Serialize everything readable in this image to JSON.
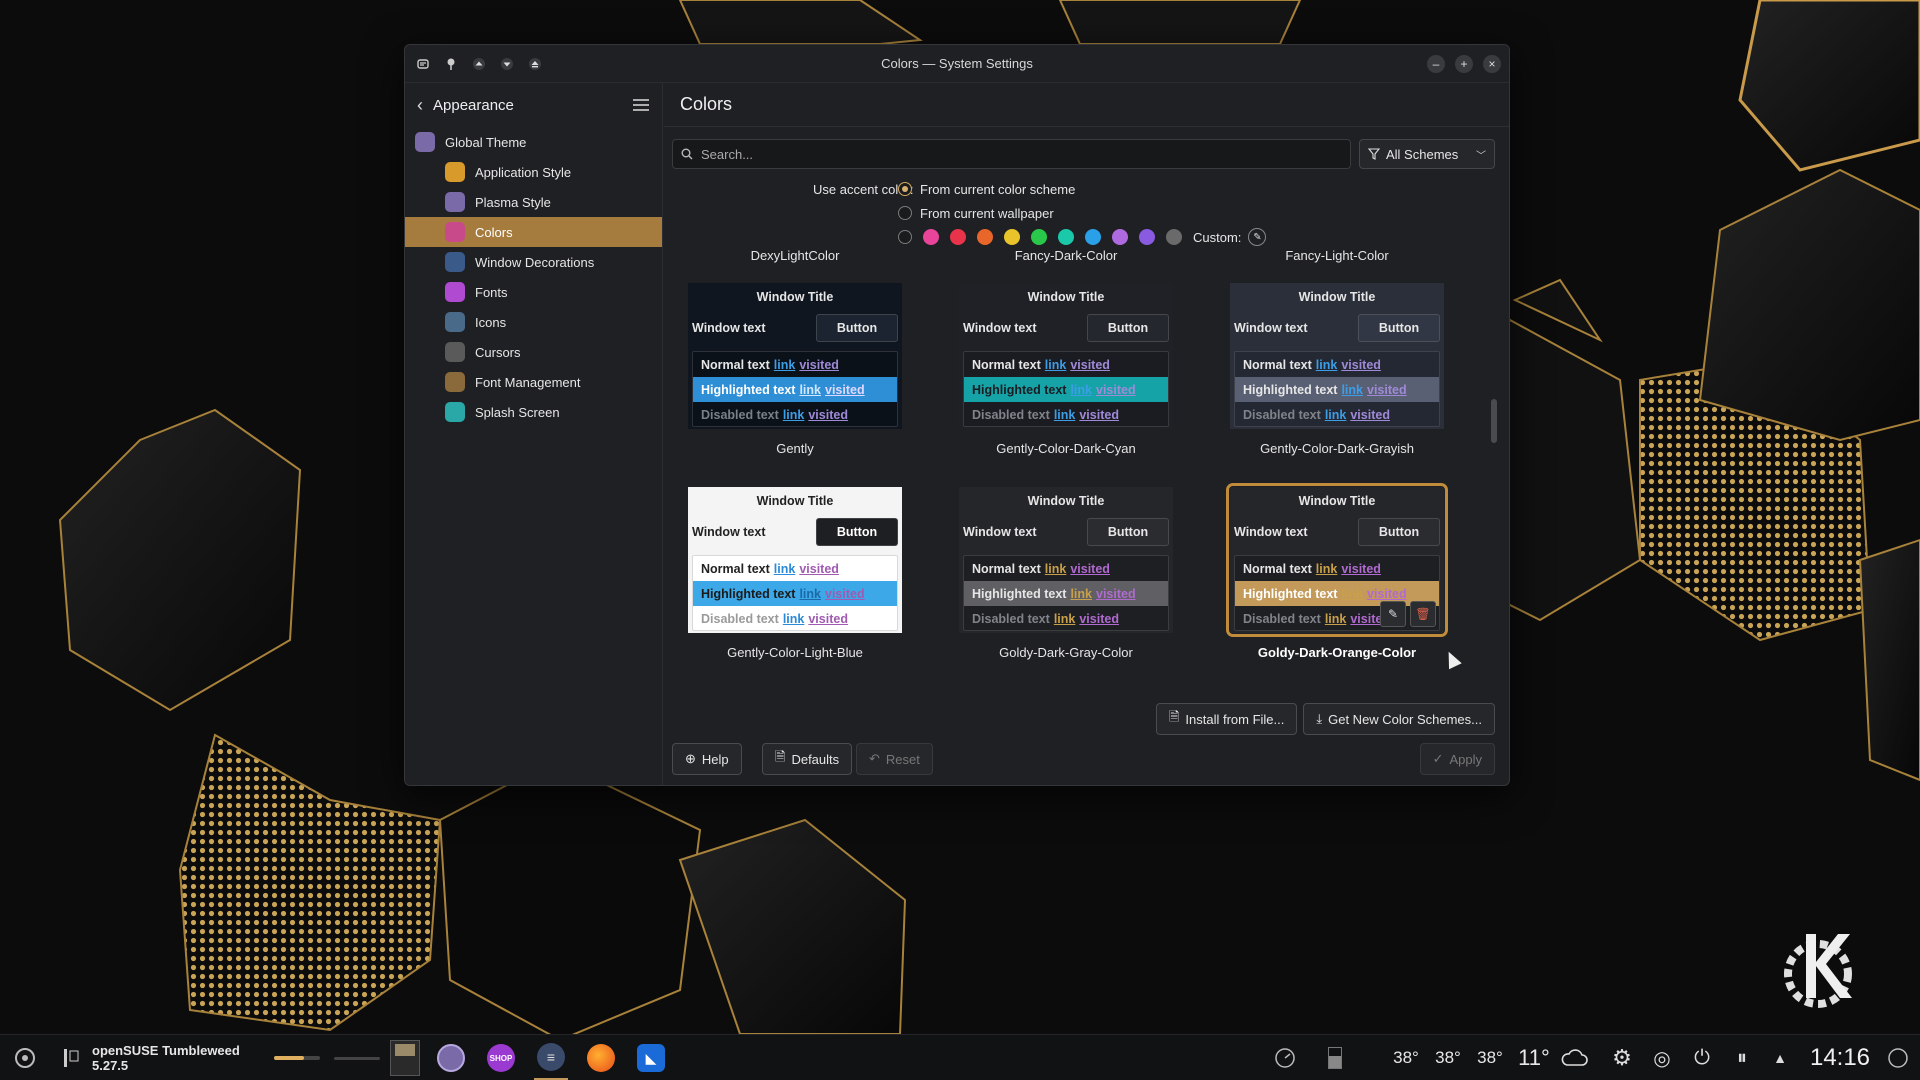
{
  "window": {
    "title": "Colors — System Settings"
  },
  "sidebar": {
    "title": "Appearance",
    "items": [
      {
        "label": "Global Theme",
        "icon": "global-theme-icon",
        "color": "#7a6aa8"
      },
      {
        "label": "Application Style",
        "icon": "application-style-icon",
        "color": "#d89a2a"
      },
      {
        "label": "Plasma Style",
        "icon": "plasma-style-icon",
        "color": "#7a6aa8"
      },
      {
        "label": "Colors",
        "icon": "colors-icon",
        "color": "#c84a8a"
      },
      {
        "label": "Window Decorations",
        "icon": "window-decorations-icon",
        "color": "#3a5a8a"
      },
      {
        "label": "Fonts",
        "icon": "fonts-icon",
        "color": "#b04ad0"
      },
      {
        "label": "Icons",
        "icon": "icons-icon",
        "color": "#4a6a8a"
      },
      {
        "label": "Cursors",
        "icon": "cursors-icon",
        "color": "#5a5a5a"
      },
      {
        "label": "Font Management",
        "icon": "font-management-icon",
        "color": "#8a6a3a"
      },
      {
        "label": "Splash Screen",
        "icon": "splash-screen-icon",
        "color": "#2aa8a8"
      }
    ],
    "selected": "Colors"
  },
  "main": {
    "title": "Colors",
    "search_placeholder": "Search...",
    "filter": "All Schemes",
    "accent": {
      "label": "Use accent color:",
      "option1": "From current color scheme",
      "option2": "From current wallpaper",
      "custom": "Custom:",
      "swatches": [
        "#e8449a",
        "#e8334a",
        "#e8662a",
        "#e8c42a",
        "#2ac84a",
        "#1ac8aa",
        "#2aa0e8",
        "#b06ae0",
        "#8a5ae0",
        "#6a6a6a"
      ]
    },
    "top_labels": [
      "DexyLightColor",
      "Fancy-Dark-Color",
      "Fancy-Light-Color"
    ],
    "schemes": [
      {
        "name": "Gently",
        "title": "Window Title",
        "window_text": "Window text",
        "button": "Button",
        "normal": "Normal text",
        "highlighted": "Highlighted text",
        "disabled": "Disabled text",
        "link": "link",
        "visited": "visited",
        "c": {
          "bg": "#0f1620",
          "title_fg": "#e6e6e6",
          "btn_bg": "#1b2430",
          "btn_fg": "#e6e6e6",
          "list_bg": "#0b1119",
          "fg": "#e6e6e6",
          "hl_bg": "#2e8fd6",
          "hl_fg": "#ffffff",
          "dis_fg": "#7a8088",
          "link": "#3d9ee8",
          "visited": "#a08ad8",
          "hl_link": "#cfe8ff",
          "hl_visited": "#e0d8ff"
        }
      },
      {
        "name": "Gently-Color-Dark-Cyan",
        "title": "Window Title",
        "window_text": "Window text",
        "button": "Button",
        "normal": "Normal text",
        "highlighted": "Highlighted text",
        "disabled": "Disabled text",
        "link": "link",
        "visited": "visited",
        "c": {
          "bg": "#1f2127",
          "title_fg": "#e6e6e6",
          "btn_bg": "#24272e",
          "btn_fg": "#e6e6e6",
          "list_bg": "#1a1c21",
          "fg": "#e6e6e6",
          "hl_bg": "#16a3a8",
          "hl_fg": "#1a1c21",
          "dis_fg": "#80848a",
          "link": "#3d9ee8",
          "visited": "#a08ad8",
          "hl_link": "#3d9ee8",
          "hl_visited": "#a08ad8"
        }
      },
      {
        "name": "Gently-Color-Dark-Grayish",
        "title": "Window Title",
        "window_text": "Window text",
        "button": "Button",
        "normal": "Normal text",
        "highlighted": "Highlighted text",
        "disabled": "Disabled text",
        "link": "link",
        "visited": "visited",
        "c": {
          "bg": "#2a2f3a",
          "title_fg": "#e6e6e6",
          "btn_bg": "#313744",
          "btn_fg": "#e6e6e6",
          "list_bg": "#232833",
          "fg": "#e6e6e6",
          "hl_bg": "#5a6074",
          "hl_fg": "#e6e6e6",
          "dis_fg": "#80848a",
          "link": "#3d9ee8",
          "visited": "#a08ad8",
          "hl_link": "#3d9ee8",
          "hl_visited": "#a08ad8"
        }
      },
      {
        "name": "Gently-Color-Light-Blue",
        "title": "Window Title",
        "window_text": "Window text",
        "button": "Button",
        "normal": "Normal text",
        "highlighted": "Highlighted text",
        "disabled": "Disabled text",
        "link": "link",
        "visited": "visited",
        "c": {
          "bg": "#f4f4f4",
          "title_fg": "#222222",
          "btn_bg": "#1e1f22",
          "btn_fg": "#ffffff",
          "list_bg": "#ffffff",
          "fg": "#222222",
          "hl_bg": "#3da8e8",
          "hl_fg": "#1a1a1a",
          "dis_fg": "#9a9a9a",
          "link": "#2a8ad8",
          "visited": "#a05ab0",
          "hl_link": "#1a6aa8",
          "hl_visited": "#a05ab0"
        }
      },
      {
        "name": "Goldy-Dark-Gray-Color",
        "title": "Window Title",
        "window_text": "Window text",
        "button": "Button",
        "normal": "Normal text",
        "highlighted": "Highlighted text",
        "disabled": "Disabled text",
        "link": "link",
        "visited": "visited",
        "c": {
          "bg": "#25262a",
          "title_fg": "#e6e6e6",
          "btn_bg": "#2b2c30",
          "btn_fg": "#e6e6e6",
          "list_bg": "#1e1f22",
          "fg": "#e6e6e6",
          "hl_bg": "#606064",
          "hl_fg": "#e6e6e6",
          "dis_fg": "#80848a",
          "link": "#c9a04a",
          "visited": "#b06ad0",
          "hl_link": "#c9a04a",
          "hl_visited": "#b06ad0"
        }
      },
      {
        "name": "Goldy-Dark-Orange-Color",
        "title": "Window Title",
        "window_text": "Window text",
        "button": "Button",
        "normal": "Normal text",
        "highlighted": "Highlighted text",
        "disabled": "Disabled text",
        "link": "link",
        "visited": "visited",
        "c": {
          "bg": "#25262a",
          "title_fg": "#e6e6e6",
          "btn_bg": "#2b2c30",
          "btn_fg": "#e6e6e6",
          "list_bg": "#1e1f22",
          "fg": "#e6e6e6",
          "hl_bg": "#c49a5a",
          "hl_fg": "#ffffff",
          "dis_fg": "#80848a",
          "link": "#c9a04a",
          "visited": "#b06ad0",
          "hl_link": "#c9a04a",
          "hl_visited": "#b06ad0"
        }
      }
    ],
    "selected_scheme": "Goldy-Dark-Orange-Color",
    "install_btn": "Install from File...",
    "get_new_btn": "Get New Color Schemes...",
    "help_btn": "Help",
    "defaults_btn": "Defaults",
    "reset_btn": "Reset",
    "apply_btn": "Apply"
  },
  "taskbar": {
    "distro": "openSUSE Tumbleweed 5.27.5",
    "temps": [
      "38°",
      "38°",
      "38°"
    ],
    "weather": "11°",
    "clock": "14:16"
  }
}
